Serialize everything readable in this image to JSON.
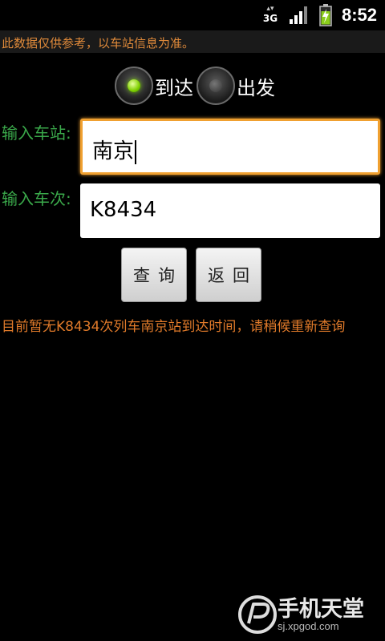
{
  "status_bar": {
    "network_top": "▴▾",
    "network_type": "3G",
    "time": "8:52"
  },
  "notice": {
    "text": "此数据仅供参考，以车站信息为准。"
  },
  "direction": {
    "options": [
      {
        "label": "到达",
        "selected": true
      },
      {
        "label": "出发",
        "selected": false
      }
    ]
  },
  "station": {
    "label": "输入车站:",
    "value": "南京"
  },
  "train": {
    "label": "输入车次:",
    "value": "K8434"
  },
  "buttons": {
    "query_label": "查询",
    "back_label": "返回"
  },
  "message": {
    "text": "目前暂无K8434次列车南京站到达时间，请稍候重新查询"
  },
  "watermark": {
    "title": "手机天堂",
    "url": "sj.xpgod.com"
  },
  "colors": {
    "label_green": "#3aa84a",
    "message_orange": "#e07a2a",
    "focus_orange": "#f0a030"
  }
}
